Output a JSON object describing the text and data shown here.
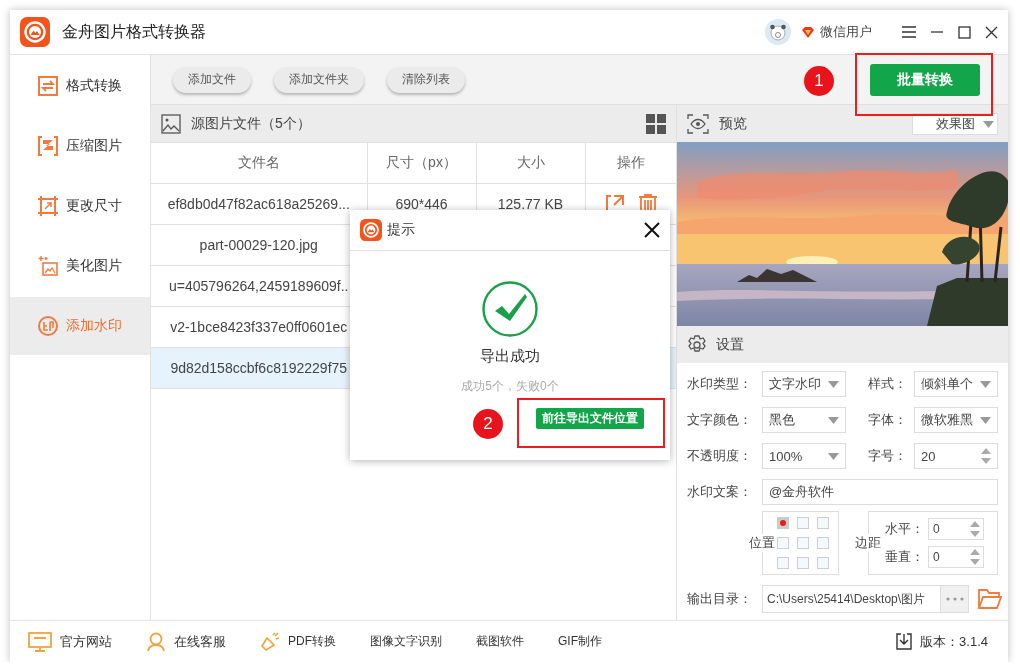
{
  "window": {
    "title": "金舟图片格式转换器",
    "user": "微信用户"
  },
  "sidebar": {
    "items": [
      {
        "label": "格式转换",
        "selected": false
      },
      {
        "label": "压缩图片",
        "selected": false
      },
      {
        "label": "更改尺寸",
        "selected": false
      },
      {
        "label": "美化图片",
        "selected": false
      },
      {
        "label": "添加水印",
        "selected": true
      }
    ]
  },
  "toolbar": {
    "buttons": [
      "添加文件",
      "添加文件夹",
      "清除列表"
    ],
    "primary_button": "批量转换"
  },
  "file_list": {
    "title": "源图片文件（5个）",
    "columns": [
      "文件名",
      "尺寸（px）",
      "大小",
      "操作"
    ],
    "rows": [
      {
        "name": "ef8db0d47f82ac618a25269...",
        "dimensions": "690*446",
        "file_size": "125.77 KB",
        "selected": false
      },
      {
        "name": "part-00029-120.jpg",
        "selected": false
      },
      {
        "name": "u=405796264,2459189609f..",
        "selected": false
      },
      {
        "name": "v2-1bce8423f337e0ff0601ec",
        "selected": false
      },
      {
        "name": "9d82d158ccbf6c8192229f75",
        "selected": true
      }
    ]
  },
  "preview": {
    "title": "预览",
    "mode": "效果图"
  },
  "settings": {
    "title": "设置",
    "fields": [
      {
        "kind": "select",
        "label": "水印类型：",
        "value": "文字水印"
      },
      {
        "kind": "select",
        "label": "样式：",
        "value": "倾斜单个"
      },
      {
        "kind": "select",
        "label": "文字颜色：",
        "value": "黑色"
      },
      {
        "kind": "select",
        "label": "字体：",
        "value": "微软雅黑"
      },
      {
        "kind": "select",
        "label": "不透明度：",
        "value": "100%"
      },
      {
        "kind": "spin",
        "label": "字号：",
        "value": "20"
      },
      {
        "kind": "text",
        "label": "水印文案：",
        "value": "@金舟软件"
      }
    ],
    "position": {
      "label": "位置",
      "cells": [
        {
          "selected": true
        },
        {
          "selected": false
        },
        {
          "selected": false
        },
        {
          "selected": false
        },
        {
          "selected": false
        },
        {
          "selected": false
        },
        {
          "selected": false
        },
        {
          "selected": false
        },
        {
          "selected": false
        }
      ]
    },
    "margin": {
      "label": "边距",
      "fields": [
        {
          "label": "水平：",
          "value": "0"
        },
        {
          "label": "垂直：",
          "value": "0"
        }
      ]
    },
    "output": {
      "label": "输出目录：",
      "value": "C:\\Users\\25414\\Desktop\\图片"
    }
  },
  "footer": {
    "links": [
      {
        "label": "官方网站"
      },
      {
        "label": "在线客服"
      },
      {
        "label": "PDF转换"
      },
      {
        "label": "图像文字识别"
      },
      {
        "label": "截图软件"
      },
      {
        "label": "GIF制作"
      }
    ],
    "version": "版本：3.1.4"
  },
  "dialog": {
    "title": "提示",
    "message": "导出成功",
    "detail": "成功5个，失败0个",
    "button": "前往导出文件位置"
  },
  "annotations": [
    {
      "label": "1"
    },
    {
      "label": "2"
    }
  ]
}
